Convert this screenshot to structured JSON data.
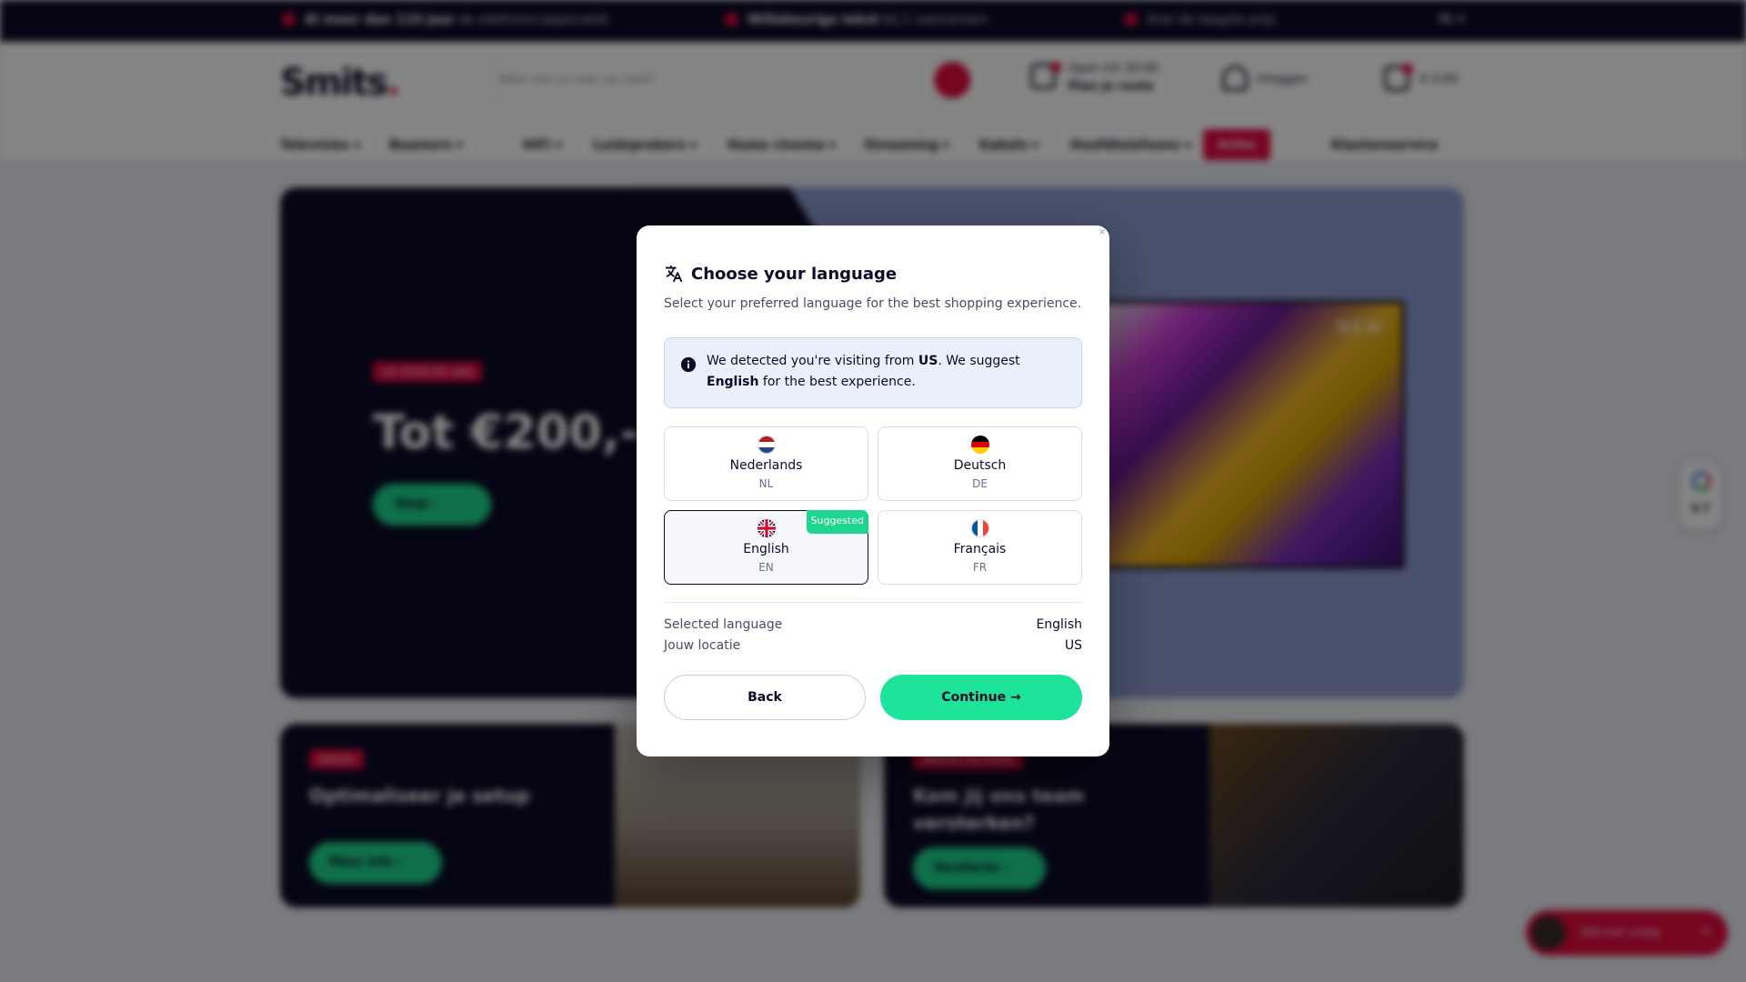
{
  "background": {
    "topbar": {
      "items": [
        {
          "bold": "Al meer dan 110 jaar",
          "text": " de elektronicaspecialist"
        },
        {
          "bold": "Willekeurige tekst",
          "text": " bij 2 vakmensen"
        },
        {
          "bold": "",
          "text": "Snel de laagste prijs"
        }
      ],
      "language": "NL"
    },
    "header": {
      "logo": "Smits",
      "logo_dot": ".",
      "search_placeholder": "Waar ben je naar op zoek?",
      "store_line1": "Open tot 20:00",
      "store_line2": "Plan je route",
      "account": "Inloggen",
      "cart": "€ 0,00"
    },
    "nav": {
      "items": [
        "Televisies",
        "Beamers",
        "HiFi",
        "Luidsprekers",
        "Home cinema",
        "Streaming",
        "Kabels",
        "Hoofdtelefoons"
      ],
      "action": "Acties",
      "service": "Klantenservice"
    },
    "hero": {
      "tag": "LG OLED 65 sale",
      "title": "Tot €200,- c",
      "button": "Shop",
      "tv_label": "NEW"
    },
    "cards": [
      {
        "tag": "Advies",
        "title": "Optimaliseer je setup",
        "button": "Meer info"
      },
      {
        "tag": "Werken bij Smits",
        "title": "Kom jij ons team versterken?",
        "button": "Vacatures"
      }
    ],
    "rating": "4.7",
    "chat": "Stel een vraag"
  },
  "modal": {
    "close": "×",
    "title": "Choose your language",
    "subtitle": "Select your preferred language for the best shopping experience.",
    "info": {
      "p1": "We detected you're visiting from ",
      "country": "US",
      "p2": ". We suggest ",
      "language": "English",
      "p3": " for the best experience."
    },
    "options": [
      {
        "name": "Nederlands",
        "code": "NL",
        "flag": "nl-flag"
      },
      {
        "name": "Deutsch",
        "code": "DE",
        "flag": "de-flag"
      },
      {
        "name": "English",
        "code": "EN",
        "flag": "gb-flag",
        "badge": "Suggested",
        "selected": true
      },
      {
        "name": "Français",
        "code": "FR",
        "flag": "fr-flag"
      }
    ],
    "summary": {
      "selected_label": "Selected language",
      "selected_value": "English",
      "location_label": "Jouw locatie",
      "location_value": "US"
    },
    "buttons": {
      "back": "Back",
      "continue": "Continue →"
    },
    "colors": {
      "accent": "#1ee39a",
      "dark": "#0d0b26",
      "info_bg": "#eaf0fb"
    }
  }
}
